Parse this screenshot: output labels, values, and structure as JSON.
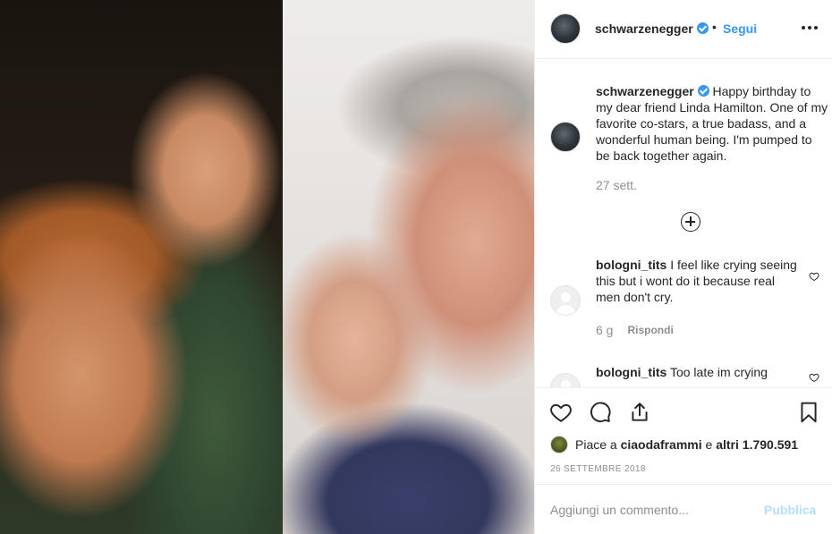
{
  "header": {
    "username": "schwarzenegger",
    "separator": "•",
    "follow_label": "Segui"
  },
  "caption": {
    "username": "schwarzenegger",
    "text": "Happy birthday to my dear friend Linda Hamilton. One of my favorite co-stars, a true badass, and a wonderful human being. I'm pumped to be back together again.",
    "time": "27 sett."
  },
  "comments": [
    {
      "username": "bologni_tits",
      "text": "I feel like crying seeing this but i wont do it because real men don't cry.",
      "time": "6 g",
      "reply_label": "Rispondi"
    },
    {
      "username": "bologni_tits",
      "text": "Too late im crying"
    }
  ],
  "likes": {
    "prefix": "Piace a",
    "user": "ciaodaframmi",
    "conjunction": "e",
    "others": "altri 1.790.591"
  },
  "date": "26 settembre 2018",
  "add_comment": {
    "placeholder": "Aggiungi un commento...",
    "publish_label": "Pubblica"
  },
  "icons": {
    "like": "heart-icon",
    "comment": "comment-icon",
    "share": "share-icon",
    "save": "bookmark-icon",
    "more": "more-options-icon",
    "load_more": "plus-circle-icon",
    "verified": "verified-badge-icon"
  },
  "colors": {
    "accent": "#3897f0",
    "muted": "#8e8e8e",
    "publish_disabled": "#b2dffc",
    "text": "#262626"
  }
}
